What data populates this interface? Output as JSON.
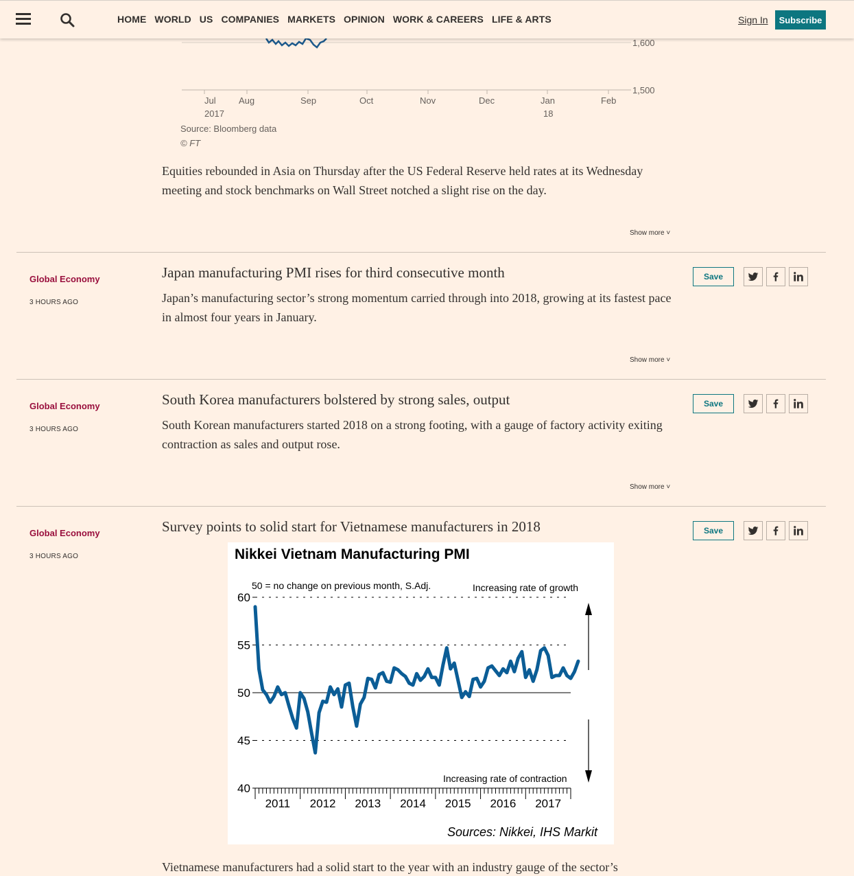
{
  "header": {
    "nav": [
      "HOME",
      "WORLD",
      "US",
      "COMPANIES",
      "MARKETS",
      "OPINION",
      "WORK & CAREERS",
      "LIFE & ARTS"
    ],
    "sign_in": "Sign In",
    "subscribe": "Subscribe"
  },
  "chart_top": {
    "y_labels": [
      "1,600",
      "1,500"
    ],
    "x_labels": [
      {
        "main": "Jul",
        "sub": "2017"
      },
      {
        "main": "Aug",
        "sub": ""
      },
      {
        "main": "Sep",
        "sub": ""
      },
      {
        "main": "Oct",
        "sub": ""
      },
      {
        "main": "Nov",
        "sub": ""
      },
      {
        "main": "Dec",
        "sub": ""
      },
      {
        "main": "Jan",
        "sub": "18"
      },
      {
        "main": "Feb",
        "sub": ""
      }
    ],
    "source": "Source: Bloomberg data",
    "credit": "© FT"
  },
  "intro_paragraph": "Equities rebounded in Asia on Thursday after the US Federal Reserve held rates at its Wednesday meeting and stock benchmarks on Wall Street notched a slight rise on the day.",
  "show_more": "Show more",
  "save_label": "Save",
  "posts": [
    {
      "category": "Global Economy",
      "time": "3 HOURS AGO",
      "headline": "Japan manufacturing PMI rises for third consecutive month",
      "standfirst": "Japan’s manufacturing sector’s strong momentum carried through into 2018, growing at its fastest pace in almost four years in January."
    },
    {
      "category": "Global Economy",
      "time": "3 HOURS AGO",
      "headline": "South Korea manufacturers bolstered by strong sales, output",
      "standfirst": "South Korean manufacturers started 2018 on a strong footing, with a gauge of factory activity exiting contraction as sales and output rose."
    },
    {
      "category": "Global Economy",
      "time": "3 HOURS AGO",
      "headline": "Survey points to solid start for Vietnamese manufacturers in 2018",
      "standfirst": "Vietnamese manufacturers had a solid start to the year with an industry gauge of the sector’s"
    }
  ],
  "chart_data": {
    "type": "line",
    "title": "Nikkei Vietnam Manufacturing PMI",
    "subtitle": "50 = no change on previous month, S.Adj.",
    "annotation_top": "Increasing rate of growth",
    "annotation_bottom": "Increasing rate of contraction",
    "source": "Sources: Nikkei, IHS Markit",
    "y_ticks": [
      "60",
      "55",
      "50",
      "45",
      "40"
    ],
    "ylim": [
      40,
      60
    ],
    "x_ticks": [
      "2011",
      "2012",
      "2013",
      "2014",
      "2015",
      "2016",
      "2017"
    ],
    "xlim": [
      2011.0,
      2018.0
    ],
    "series": [
      {
        "values": [
          59.0,
          52.5,
          50.3,
          49.8,
          49.0,
          49.6,
          50.6,
          49.8,
          50.0,
          48.6,
          47.3,
          46.3,
          50.0,
          49.4,
          48.0,
          45.8,
          43.7,
          47.9,
          49.1,
          49.0,
          50.6,
          49.8,
          50.4,
          48.5,
          50.8,
          51.0,
          48.5,
          46.5,
          48.8,
          49.5,
          51.5,
          51.4,
          50.5,
          51.9,
          52.1,
          51.2,
          51.1,
          52.6,
          52.4,
          52.0,
          51.7,
          51.0,
          50.8,
          52.0,
          51.3,
          51.7,
          52.5,
          51.6,
          51.6,
          50.8,
          52.9,
          54.7,
          52.5,
          53.1,
          51.3,
          49.5,
          50.1,
          49.6,
          51.4,
          51.5,
          50.6,
          51.2,
          52.6,
          52.8,
          52.3,
          51.8,
          52.5,
          52.1,
          53.3,
          52.2,
          53.6,
          54.3,
          51.6,
          52.4,
          51.2,
          52.4,
          54.4,
          54.7,
          53.9,
          51.6,
          51.8,
          51.8,
          52.6,
          51.8,
          51.5,
          52.2,
          53.3
        ]
      }
    ],
    "reference_line": 50,
    "grid": "dashed at 45, 55, 60"
  }
}
